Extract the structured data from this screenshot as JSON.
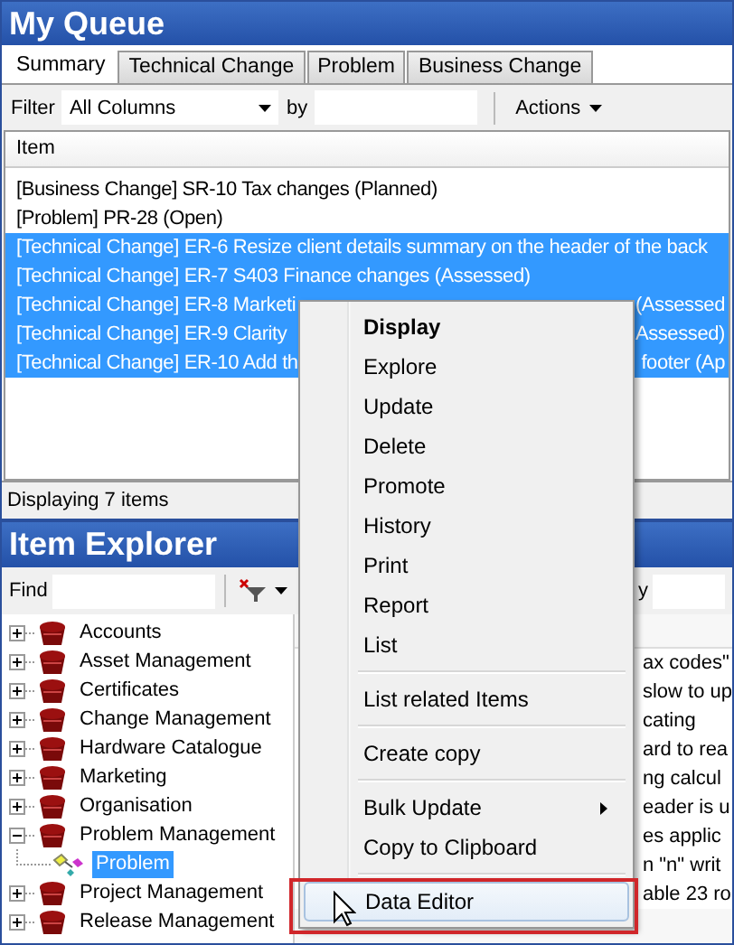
{
  "queue": {
    "title": "My Queue",
    "tabs": [
      {
        "label": "Summary",
        "selected": true
      },
      {
        "label": "Technical Change",
        "selected": false
      },
      {
        "label": "Problem",
        "selected": false
      },
      {
        "label": "Business Change",
        "selected": false
      }
    ],
    "filter": {
      "label": "Filter",
      "dropdown": "All Columns",
      "by_label": "by",
      "actions": "Actions"
    },
    "column": "Item",
    "rows": [
      {
        "text": "[Business Change] SR-10 Tax changes (Planned)",
        "selected": false
      },
      {
        "text": "[Problem] PR-28  (Open)",
        "selected": false
      },
      {
        "text": "[Technical Change] ER-6 Resize client details summary on the header of the back",
        "selected": true
      },
      {
        "text": "[Technical Change] ER-7 S403 Finance changes (Assessed)",
        "selected": true
      },
      {
        "text": "[Technical Change] ER-8 Marketi",
        "text_right": "(Assessed",
        "selected": true
      },
      {
        "text": "[Technical Change] ER-9 Clarity",
        "text_right": "Assessed)",
        "selected": true
      },
      {
        "text": "[Technical Change] ER-10 Add th",
        "text_right": "footer (Ap",
        "selected": true
      }
    ],
    "status": "Displaying 7 items"
  },
  "explorer": {
    "title": "Item Explorer",
    "find_label": "Find",
    "toolbar_fragment": "y",
    "tree": [
      {
        "label": "Accounts",
        "expanded": false,
        "selected": false
      },
      {
        "label": "Asset Management",
        "expanded": false,
        "selected": false
      },
      {
        "label": "Certificates",
        "expanded": false,
        "selected": false
      },
      {
        "label": "Change Management",
        "expanded": false,
        "selected": false
      },
      {
        "label": "Hardware Catalogue",
        "expanded": false,
        "selected": false
      },
      {
        "label": "Marketing",
        "expanded": false,
        "selected": false
      },
      {
        "label": "Organisation",
        "expanded": false,
        "selected": false
      },
      {
        "label": "Problem Management",
        "expanded": true,
        "selected": false,
        "children": [
          {
            "label": "Problem",
            "selected": true
          }
        ]
      },
      {
        "label": "Project Management",
        "expanded": false,
        "selected": false
      },
      {
        "label": "Release Management",
        "expanded": false,
        "selected": false
      }
    ],
    "grid_rows": [
      "ax codes\"",
      "slow to up",
      "cating",
      "ard to rea",
      "ng calcul",
      "eader is u",
      "es applic",
      "n \"n\" writ",
      "able 23 ro"
    ]
  },
  "context_menu": [
    {
      "kind": "default",
      "label": "Display",
      "selected": false
    },
    {
      "kind": "item",
      "label": "Explore",
      "selected": false
    },
    {
      "kind": "item",
      "label": "Update",
      "selected": false
    },
    {
      "kind": "item",
      "label": "Delete",
      "selected": false
    },
    {
      "kind": "item",
      "label": "Promote",
      "selected": false
    },
    {
      "kind": "item",
      "label": "History",
      "selected": false
    },
    {
      "kind": "item",
      "label": "Print",
      "selected": false
    },
    {
      "kind": "item",
      "label": "Report",
      "selected": false
    },
    {
      "kind": "item",
      "label": "List",
      "selected": false
    },
    {
      "kind": "separator"
    },
    {
      "kind": "item",
      "label": "List related Items",
      "selected": false
    },
    {
      "kind": "separator"
    },
    {
      "kind": "item",
      "label": "Create copy",
      "selected": false
    },
    {
      "kind": "separator"
    },
    {
      "kind": "submenu",
      "label": "Bulk Update",
      "selected": false
    },
    {
      "kind": "item",
      "label": "Copy to Clipboard",
      "selected": false
    },
    {
      "kind": "separator"
    },
    {
      "kind": "item",
      "label": "Data Editor",
      "selected": true
    }
  ]
}
